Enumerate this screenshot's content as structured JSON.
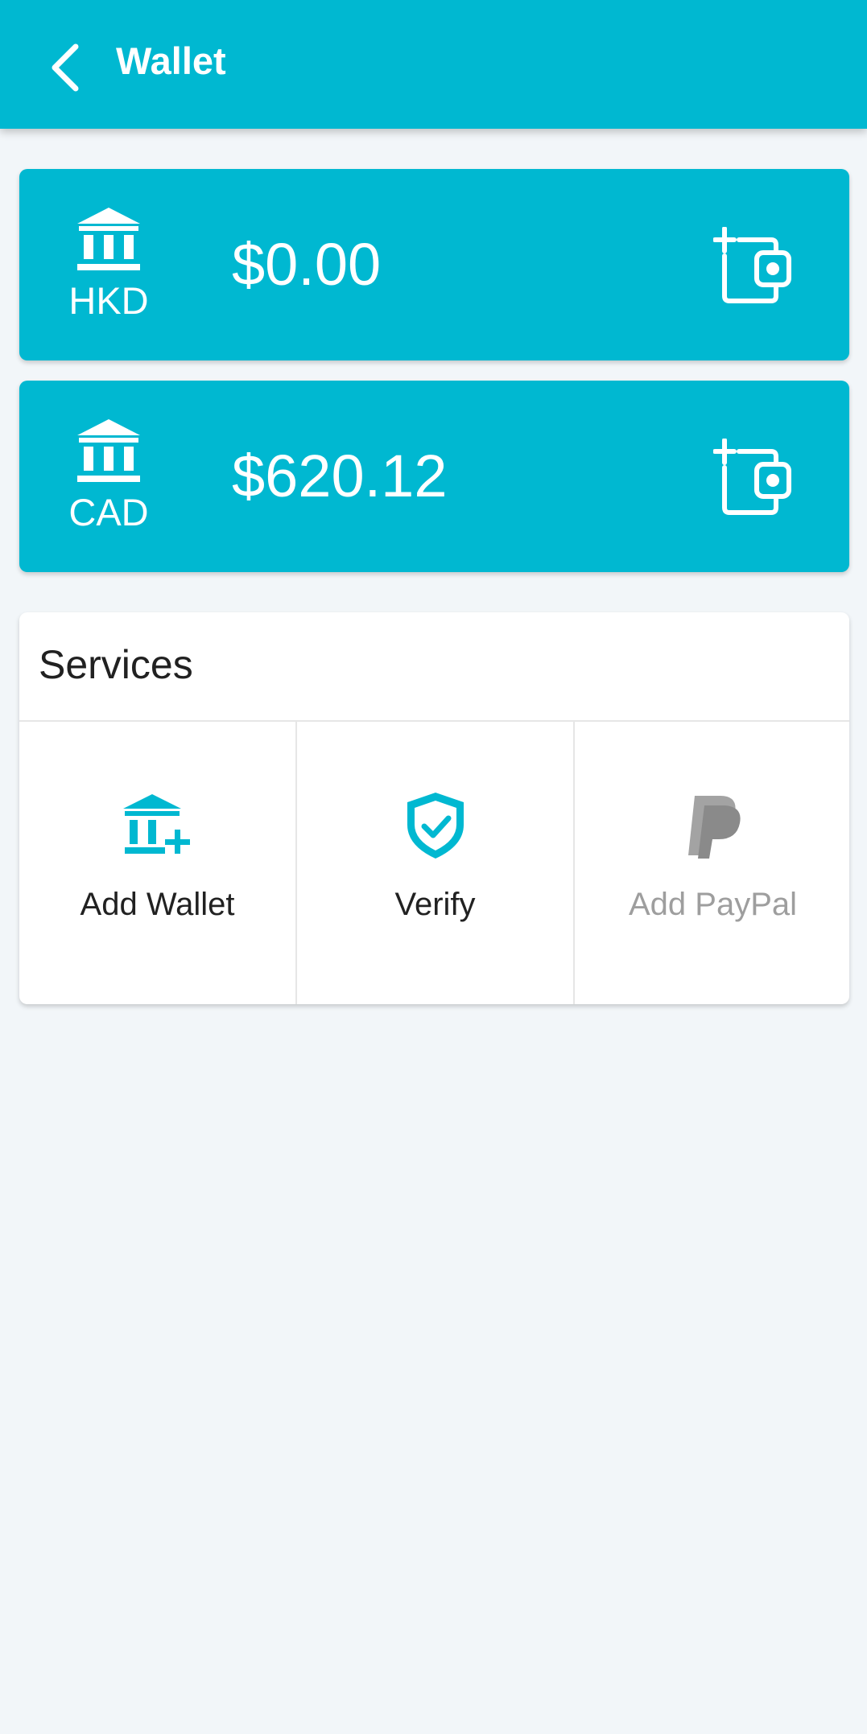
{
  "header": {
    "title": "Wallet",
    "back_icon": "chevron-left-icon"
  },
  "wallets": [
    {
      "currency": "HKD",
      "balance": "$0.00",
      "icon": "bank-icon",
      "action_icon": "add-wallet-icon"
    },
    {
      "currency": "CAD",
      "balance": "$620.12",
      "icon": "bank-icon",
      "action_icon": "add-wallet-icon"
    }
  ],
  "services": {
    "title": "Services",
    "items": [
      {
        "label": "Add Wallet",
        "icon": "bank-plus-icon",
        "enabled": true
      },
      {
        "label": "Verify",
        "icon": "shield-check-icon",
        "enabled": true
      },
      {
        "label": "Add PayPal",
        "icon": "paypal-icon",
        "enabled": false
      }
    ]
  },
  "colors": {
    "primary": "#00b8d1",
    "background": "#f2f6f9",
    "card": "#ffffff",
    "text": "#212121",
    "disabled": "#9e9e9e"
  }
}
